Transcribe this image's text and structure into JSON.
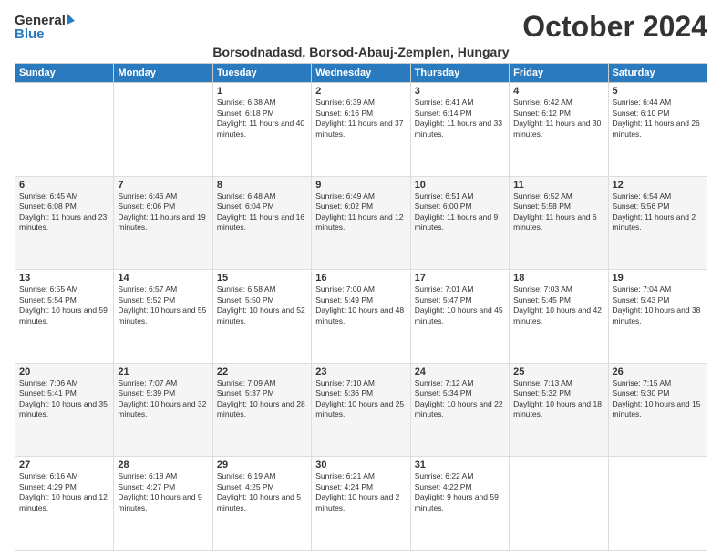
{
  "header": {
    "logo_general": "General",
    "logo_blue": "Blue",
    "month_title": "October 2024",
    "location": "Borsodnadasd, Borsod-Abauj-Zemplen, Hungary"
  },
  "days_of_week": [
    "Sunday",
    "Monday",
    "Tuesday",
    "Wednesday",
    "Thursday",
    "Friday",
    "Saturday"
  ],
  "weeks": [
    [
      {
        "day": "",
        "sunrise": "",
        "sunset": "",
        "daylight": ""
      },
      {
        "day": "",
        "sunrise": "",
        "sunset": "",
        "daylight": ""
      },
      {
        "day": "1",
        "sunrise": "Sunrise: 6:38 AM",
        "sunset": "Sunset: 6:18 PM",
        "daylight": "Daylight: 11 hours and 40 minutes."
      },
      {
        "day": "2",
        "sunrise": "Sunrise: 6:39 AM",
        "sunset": "Sunset: 6:16 PM",
        "daylight": "Daylight: 11 hours and 37 minutes."
      },
      {
        "day": "3",
        "sunrise": "Sunrise: 6:41 AM",
        "sunset": "Sunset: 6:14 PM",
        "daylight": "Daylight: 11 hours and 33 minutes."
      },
      {
        "day": "4",
        "sunrise": "Sunrise: 6:42 AM",
        "sunset": "Sunset: 6:12 PM",
        "daylight": "Daylight: 11 hours and 30 minutes."
      },
      {
        "day": "5",
        "sunrise": "Sunrise: 6:44 AM",
        "sunset": "Sunset: 6:10 PM",
        "daylight": "Daylight: 11 hours and 26 minutes."
      }
    ],
    [
      {
        "day": "6",
        "sunrise": "Sunrise: 6:45 AM",
        "sunset": "Sunset: 6:08 PM",
        "daylight": "Daylight: 11 hours and 23 minutes."
      },
      {
        "day": "7",
        "sunrise": "Sunrise: 6:46 AM",
        "sunset": "Sunset: 6:06 PM",
        "daylight": "Daylight: 11 hours and 19 minutes."
      },
      {
        "day": "8",
        "sunrise": "Sunrise: 6:48 AM",
        "sunset": "Sunset: 6:04 PM",
        "daylight": "Daylight: 11 hours and 16 minutes."
      },
      {
        "day": "9",
        "sunrise": "Sunrise: 6:49 AM",
        "sunset": "Sunset: 6:02 PM",
        "daylight": "Daylight: 11 hours and 12 minutes."
      },
      {
        "day": "10",
        "sunrise": "Sunrise: 6:51 AM",
        "sunset": "Sunset: 6:00 PM",
        "daylight": "Daylight: 11 hours and 9 minutes."
      },
      {
        "day": "11",
        "sunrise": "Sunrise: 6:52 AM",
        "sunset": "Sunset: 5:58 PM",
        "daylight": "Daylight: 11 hours and 6 minutes."
      },
      {
        "day": "12",
        "sunrise": "Sunrise: 6:54 AM",
        "sunset": "Sunset: 5:56 PM",
        "daylight": "Daylight: 11 hours and 2 minutes."
      }
    ],
    [
      {
        "day": "13",
        "sunrise": "Sunrise: 6:55 AM",
        "sunset": "Sunset: 5:54 PM",
        "daylight": "Daylight: 10 hours and 59 minutes."
      },
      {
        "day": "14",
        "sunrise": "Sunrise: 6:57 AM",
        "sunset": "Sunset: 5:52 PM",
        "daylight": "Daylight: 10 hours and 55 minutes."
      },
      {
        "day": "15",
        "sunrise": "Sunrise: 6:58 AM",
        "sunset": "Sunset: 5:50 PM",
        "daylight": "Daylight: 10 hours and 52 minutes."
      },
      {
        "day": "16",
        "sunrise": "Sunrise: 7:00 AM",
        "sunset": "Sunset: 5:49 PM",
        "daylight": "Daylight: 10 hours and 48 minutes."
      },
      {
        "day": "17",
        "sunrise": "Sunrise: 7:01 AM",
        "sunset": "Sunset: 5:47 PM",
        "daylight": "Daylight: 10 hours and 45 minutes."
      },
      {
        "day": "18",
        "sunrise": "Sunrise: 7:03 AM",
        "sunset": "Sunset: 5:45 PM",
        "daylight": "Daylight: 10 hours and 42 minutes."
      },
      {
        "day": "19",
        "sunrise": "Sunrise: 7:04 AM",
        "sunset": "Sunset: 5:43 PM",
        "daylight": "Daylight: 10 hours and 38 minutes."
      }
    ],
    [
      {
        "day": "20",
        "sunrise": "Sunrise: 7:06 AM",
        "sunset": "Sunset: 5:41 PM",
        "daylight": "Daylight: 10 hours and 35 minutes."
      },
      {
        "day": "21",
        "sunrise": "Sunrise: 7:07 AM",
        "sunset": "Sunset: 5:39 PM",
        "daylight": "Daylight: 10 hours and 32 minutes."
      },
      {
        "day": "22",
        "sunrise": "Sunrise: 7:09 AM",
        "sunset": "Sunset: 5:37 PM",
        "daylight": "Daylight: 10 hours and 28 minutes."
      },
      {
        "day": "23",
        "sunrise": "Sunrise: 7:10 AM",
        "sunset": "Sunset: 5:36 PM",
        "daylight": "Daylight: 10 hours and 25 minutes."
      },
      {
        "day": "24",
        "sunrise": "Sunrise: 7:12 AM",
        "sunset": "Sunset: 5:34 PM",
        "daylight": "Daylight: 10 hours and 22 minutes."
      },
      {
        "day": "25",
        "sunrise": "Sunrise: 7:13 AM",
        "sunset": "Sunset: 5:32 PM",
        "daylight": "Daylight: 10 hours and 18 minutes."
      },
      {
        "day": "26",
        "sunrise": "Sunrise: 7:15 AM",
        "sunset": "Sunset: 5:30 PM",
        "daylight": "Daylight: 10 hours and 15 minutes."
      }
    ],
    [
      {
        "day": "27",
        "sunrise": "Sunrise: 6:16 AM",
        "sunset": "Sunset: 4:29 PM",
        "daylight": "Daylight: 10 hours and 12 minutes."
      },
      {
        "day": "28",
        "sunrise": "Sunrise: 6:18 AM",
        "sunset": "Sunset: 4:27 PM",
        "daylight": "Daylight: 10 hours and 9 minutes."
      },
      {
        "day": "29",
        "sunrise": "Sunrise: 6:19 AM",
        "sunset": "Sunset: 4:25 PM",
        "daylight": "Daylight: 10 hours and 5 minutes."
      },
      {
        "day": "30",
        "sunrise": "Sunrise: 6:21 AM",
        "sunset": "Sunset: 4:24 PM",
        "daylight": "Daylight: 10 hours and 2 minutes."
      },
      {
        "day": "31",
        "sunrise": "Sunrise: 6:22 AM",
        "sunset": "Sunset: 4:22 PM",
        "daylight": "Daylight: 9 hours and 59 minutes."
      },
      {
        "day": "",
        "sunrise": "",
        "sunset": "",
        "daylight": ""
      },
      {
        "day": "",
        "sunrise": "",
        "sunset": "",
        "daylight": ""
      }
    ]
  ]
}
